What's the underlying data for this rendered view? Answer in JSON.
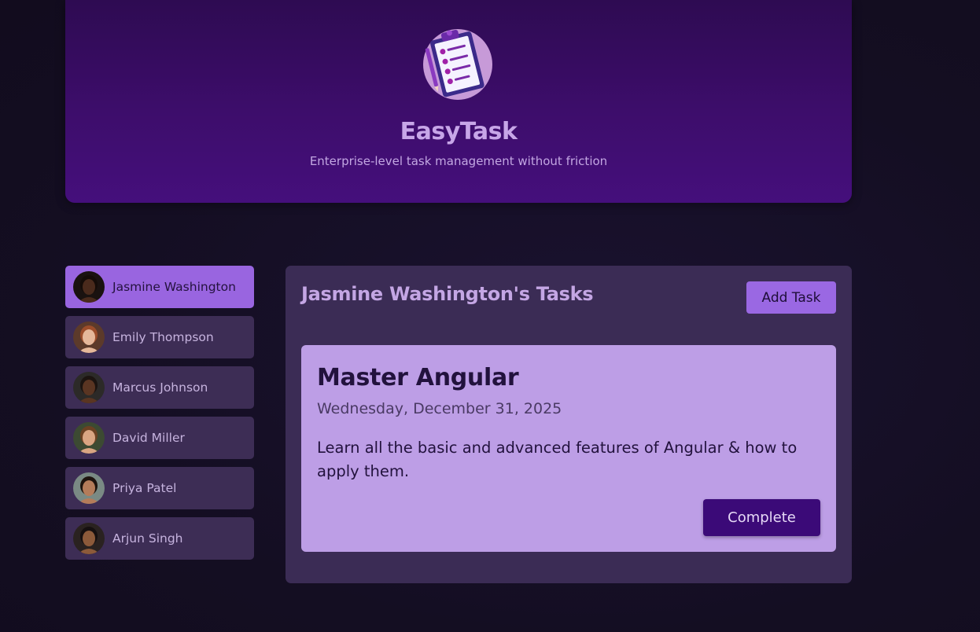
{
  "header": {
    "logo_icon": "clipboard-checklist-icon",
    "title": "EasyTask",
    "subtitle": "Enterprise-level task management without friction"
  },
  "users": [
    {
      "name": "Jasmine Washington",
      "active": true,
      "skin": "#4a2a1c",
      "hair": "#150c08",
      "bg": "#1a1210"
    },
    {
      "name": "Emily Thompson",
      "active": false,
      "skin": "#e6b89a",
      "hair": "#9c4d2a",
      "bg": "#5c3a2a"
    },
    {
      "name": "Marcus Johnson",
      "active": false,
      "skin": "#5a3522",
      "hair": "#1c1410",
      "bg": "#2c2a28"
    },
    {
      "name": "David Miller",
      "active": false,
      "skin": "#d9a582",
      "hair": "#6b4122",
      "bg": "#3c4a32"
    },
    {
      "name": "Priya Patel",
      "active": false,
      "skin": "#b47c5a",
      "hair": "#1e140e",
      "bg": "#7a8a84"
    },
    {
      "name": "Arjun Singh",
      "active": false,
      "skin": "#8c5a3a",
      "hair": "#161010",
      "bg": "#2a2220"
    }
  ],
  "tasks_panel": {
    "title": "Jasmine Washington's Tasks",
    "add_task_label": "Add Task"
  },
  "task": {
    "title": "Master Angular",
    "date": "Wednesday, December 31, 2025",
    "description": "Learn all the basic and advanced features of Angular & how to apply them.",
    "complete_label": "Complete"
  }
}
